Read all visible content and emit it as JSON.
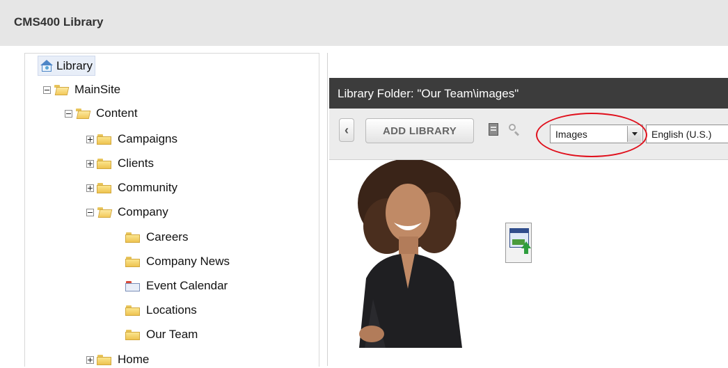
{
  "app": {
    "title": "CMS400 Library"
  },
  "tree": {
    "root_label": "Library",
    "nodes": [
      {
        "label": "MainSite",
        "toggle": "minus"
      },
      {
        "label": "Content",
        "toggle": "minus"
      },
      {
        "label": "Campaigns",
        "toggle": "plus"
      },
      {
        "label": "Clients",
        "toggle": "plus"
      },
      {
        "label": "Community",
        "toggle": "plus"
      },
      {
        "label": "Company",
        "toggle": "minus"
      },
      {
        "label": "Careers"
      },
      {
        "label": "Company News"
      },
      {
        "label": "Event Calendar"
      },
      {
        "label": "Locations"
      },
      {
        "label": "Our Team"
      },
      {
        "label": "Home",
        "toggle": "plus"
      }
    ]
  },
  "panel": {
    "title": "Library Folder: \"Our Team\\images\"",
    "back_label": "‹",
    "add_library_label": "ADD LIBRARY",
    "type_select": {
      "selected": "Images"
    },
    "language_select": {
      "selected": "English (U.S.)"
    }
  },
  "icons": {
    "root": "library-home-icon",
    "view": "view-icon",
    "search": "search-icon",
    "upload": "image-upload-icon"
  },
  "colors": {
    "header_bg": "#e6e6e6",
    "panel_title_bg": "#3c3c3c",
    "highlight": "#e0101c"
  }
}
